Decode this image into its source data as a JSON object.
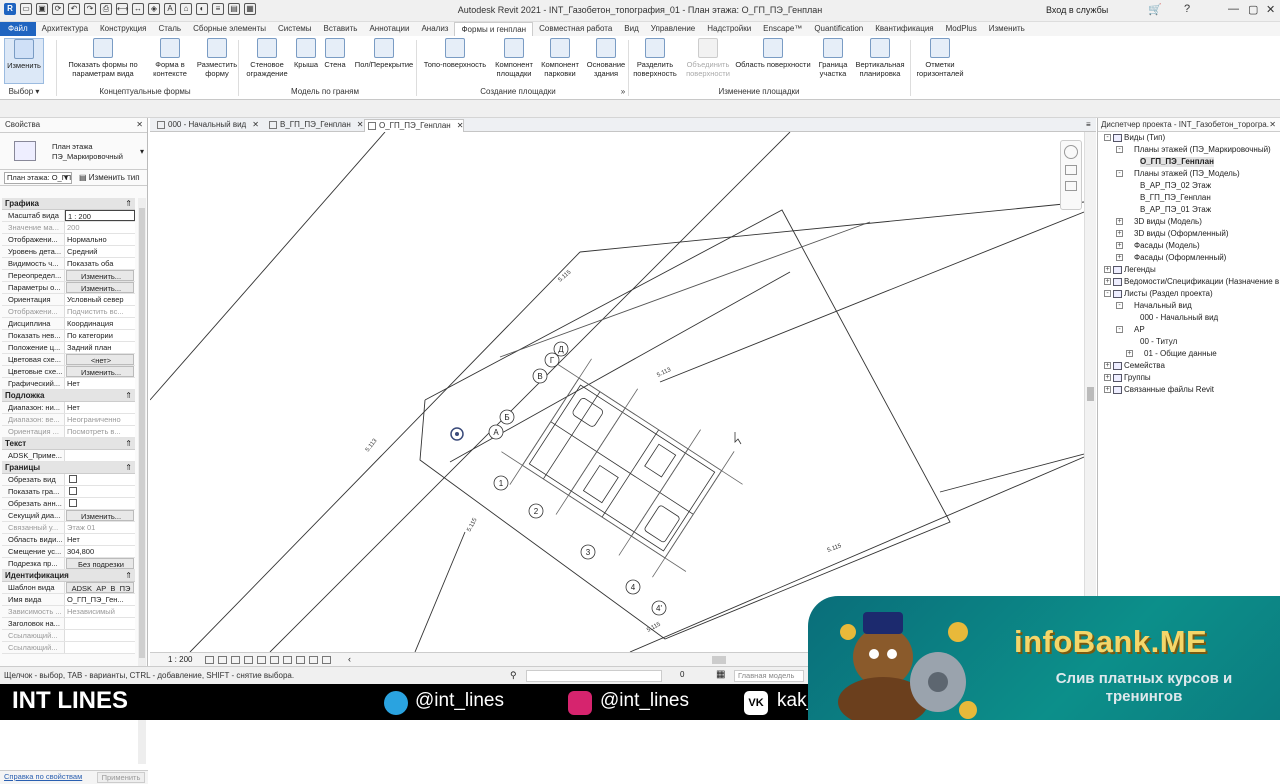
{
  "window": {
    "title": "Autodesk Revit 2021 - INT_Газобетон_топография_01 - План этажа: О_ГП_ПЭ_Генплан",
    "sign_in": "Вход в службы"
  },
  "menu_tabs": [
    "Файл",
    "Архитектура",
    "Конструкция",
    "Сталь",
    "Сборные элементы",
    "Системы",
    "Вставить",
    "Аннотации",
    "Анализ",
    "Формы и генплан",
    "Совместная работа",
    "Вид",
    "Управление",
    "Надстройки",
    "Enscape™",
    "Quantification",
    "Квантификация",
    "ModPlus",
    "Изменить"
  ],
  "ribbon": {
    "buttons": [
      {
        "label": "Изменить",
        "state": "selected"
      },
      {
        "label": "Показать формы по параметрам вида",
        "state": "normal"
      },
      {
        "label": "Форма в контексте",
        "state": "normal"
      },
      {
        "label": "Разместить форму",
        "state": "normal"
      },
      {
        "label": "Стеновое ограждение",
        "state": "normal"
      },
      {
        "label": "Крыша",
        "state": "normal"
      },
      {
        "label": "Стена",
        "state": "normal"
      },
      {
        "label": "Пол/Перекрытие",
        "state": "normal"
      },
      {
        "label": "Топо-поверхность",
        "state": "normal"
      },
      {
        "label": "Компонент площадки",
        "state": "normal"
      },
      {
        "label": "Компонент парковки",
        "state": "normal"
      },
      {
        "label": "Основание здания",
        "state": "normal"
      },
      {
        "label": "Разделить поверхность",
        "state": "normal"
      },
      {
        "label": "Объединить поверхности",
        "state": "disabled"
      },
      {
        "label": "Область поверхности",
        "state": "normal"
      },
      {
        "label": "Граница участка",
        "state": "normal"
      },
      {
        "label": "Вертикальная планировка",
        "state": "normal"
      },
      {
        "label": "Отметки горизонталей",
        "state": "normal"
      }
    ],
    "groups": [
      "Выбор ▾",
      "Концептуальные формы",
      "Модель по граням",
      "Создание площадки",
      "»",
      "Изменение площадки"
    ]
  },
  "properties": {
    "title": "Свойства",
    "type_name": "План этажа ПЭ_Маркировочный",
    "selector": "План этажа: О_ГП_",
    "edit_type": "Изменить тип",
    "rows": [
      {
        "kind": "section",
        "label": "Графика"
      },
      {
        "k": "Масштаб вида",
        "v": "1 : 200",
        "style": "box"
      },
      {
        "k": "Значение ма...",
        "v": "200",
        "style": "gray"
      },
      {
        "k": "Отображени...",
        "v": "Нормально"
      },
      {
        "k": "Уровень дета...",
        "v": "Средний"
      },
      {
        "k": "Видимость ч...",
        "v": "Показать оба"
      },
      {
        "k": "Переопредел...",
        "v": "Изменить...",
        "style": "btn"
      },
      {
        "k": "Параметры о...",
        "v": "Изменить...",
        "style": "btn"
      },
      {
        "k": "Ориентация",
        "v": "Условный север"
      },
      {
        "k": "Отображени...",
        "v": "Подчистить вс...",
        "style": "gray"
      },
      {
        "k": "Дисциплина",
        "v": "Координация"
      },
      {
        "k": "Показать нев...",
        "v": "По категории"
      },
      {
        "k": "Положение ц...",
        "v": "Задний план"
      },
      {
        "k": "Цветовая схе...",
        "v": "<нет>",
        "style": "btn"
      },
      {
        "k": "Цветовые схе...",
        "v": "Изменить...",
        "style": "btn"
      },
      {
        "k": "Графический...",
        "v": "Нет"
      },
      {
        "kind": "section",
        "label": "Подложка"
      },
      {
        "k": "Диапазон: ни...",
        "v": "Нет"
      },
      {
        "k": "Диапазон: ве...",
        "v": "Неограниченно",
        "style": "gray"
      },
      {
        "k": "Ориентация ...",
        "v": "Посмотреть в...",
        "style": "gray"
      },
      {
        "kind": "section",
        "label": "Текст"
      },
      {
        "k": "ADSK_Приме...",
        "v": ""
      },
      {
        "kind": "section",
        "label": "Границы"
      },
      {
        "k": "Обрезать вид",
        "v": "",
        "style": "check"
      },
      {
        "k": "Показать гра...",
        "v": "",
        "style": "check"
      },
      {
        "k": "Обрезать анн...",
        "v": "",
        "style": "check"
      },
      {
        "k": "Секущий диа...",
        "v": "Изменить...",
        "style": "btn"
      },
      {
        "k": "Связанный у...",
        "v": "Этаж 01",
        "style": "gray"
      },
      {
        "k": "Область види...",
        "v": "Нет"
      },
      {
        "k": "Смещение ус...",
        "v": "304,800"
      },
      {
        "k": "Подрезка пр...",
        "v": "Без подрезки",
        "style": "btn"
      },
      {
        "kind": "section",
        "label": "Идентификация"
      },
      {
        "k": "Шаблон вида",
        "v": "ADSK_АР_В_ПЭ",
        "style": "btn"
      },
      {
        "k": "Имя вида",
        "v": "О_ГП_ПЭ_Ген..."
      },
      {
        "k": "Зависимость ...",
        "v": "Независимый",
        "style": "gray"
      },
      {
        "k": "Заголовок на...",
        "v": ""
      },
      {
        "k": "Ссылающий...",
        "v": "",
        "style": "gray"
      },
      {
        "k": "Ссылающий...",
        "v": "",
        "style": "gray"
      }
    ],
    "help_link": "Справка по свойствам",
    "apply": "Применить"
  },
  "doc_tabs": [
    {
      "label": "000 - Начальный вид",
      "active": false
    },
    {
      "label": "В_ГП_ПЭ_Генплан",
      "active": false
    },
    {
      "label": "О_ГП_ПЭ_Генплан",
      "active": true
    }
  ],
  "canvas": {
    "grid_letters": [
      "А",
      "Б",
      "В",
      "Г",
      "Д"
    ],
    "grid_numbers": [
      "1",
      "2",
      "3",
      "4",
      "4'"
    ],
    "contour_labels": [
      "5.115",
      "5.113",
      "5.113",
      "5.115",
      "5.115",
      "5.115"
    ]
  },
  "view_control": {
    "scale": "1 : 200",
    "model": "Главная модель",
    "sel_count": "0"
  },
  "browser": {
    "title": "Диспетчер проекта - INT_Газобетон_тopогра...",
    "items": [
      {
        "label": "Виды (Тип)",
        "exp": "-"
      },
      {
        "label": "Планы этажей (ПЭ_Маркировочный)",
        "exp": "-"
      },
      {
        "label": "О_ГП_ПЭ_Генплан",
        "exp": "",
        "bold": true
      },
      {
        "label": "Планы этажей (ПЭ_Модель)",
        "exp": "-"
      },
      {
        "label": "В_АР_ПЭ_02 Этаж",
        "exp": ""
      },
      {
        "label": "В_ГП_ПЭ_Генплан",
        "exp": ""
      },
      {
        "label": "В_АР_ПЭ_01 Этаж",
        "exp": ""
      },
      {
        "label": "3D виды (Модель)",
        "exp": "+"
      },
      {
        "label": "3D виды (Оформленный)",
        "exp": "+"
      },
      {
        "label": "Фасады (Модель)",
        "exp": "+"
      },
      {
        "label": "Фасады (Оформленный)",
        "exp": "+"
      },
      {
        "label": "Легенды",
        "exp": "+"
      },
      {
        "label": "Ведомости/Спецификации (Назначение в",
        "exp": "+"
      },
      {
        "label": "Листы (Раздел проекта)",
        "exp": "-"
      },
      {
        "label": "Начальный вид",
        "exp": "-"
      },
      {
        "label": "000 - Начальный вид",
        "exp": ""
      },
      {
        "label": "АР",
        "exp": "-"
      },
      {
        "label": "00 - Титул",
        "exp": ""
      },
      {
        "label": "01 - Общие данные",
        "exp": "+"
      },
      {
        "label": "Семейства",
        "exp": "+"
      },
      {
        "label": "Группы",
        "exp": "+"
      },
      {
        "label": "Связанные файлы Revit",
        "exp": "+"
      }
    ]
  },
  "status": {
    "text": "Щелчок - выбор, TAB - варианты, CTRL - добавление, SHIFT - снятие выбора."
  },
  "overlay": {
    "brand": "INT LINES",
    "telegram": "@int_lines",
    "instagram": "@int_lines",
    "vk": "kak_",
    "banner_title": "infoBank.ME",
    "banner_sub": "Слив платных курсов и тренингов",
    "colors": {
      "telegram": "#2aa3e0",
      "instagram": "#d6246e",
      "gold": "#f4d66a",
      "teal": "#0c8f8a"
    }
  }
}
